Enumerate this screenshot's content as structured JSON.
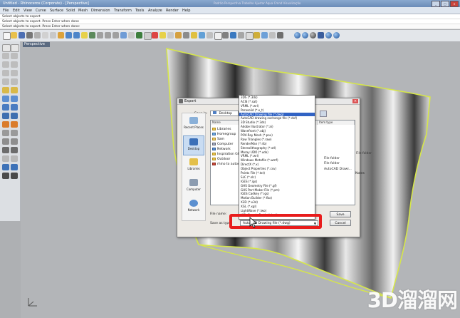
{
  "window": {
    "title": "Untitled - Rhinoceros (Corporate) - [Perspective]",
    "menu_extra": "Padrão  Perspectiva  Trabalho  Ajustar  Aqua  Cmnd  Visualização"
  },
  "menu": [
    "File",
    "Edit",
    "View",
    "Curve",
    "Surface",
    "Solid",
    "Mesh",
    "Dimension",
    "Transform",
    "Tools",
    "Analyze",
    "Render",
    "Help"
  ],
  "command": {
    "line1": "Select objects to export",
    "line2": "Select objects to export. Press Enter when done",
    "line3": "Select objects to export. Press Enter when done:"
  },
  "viewport": {
    "tab_label": "Perspective"
  },
  "dialog": {
    "title": "Export",
    "save_in_label": "Save in:",
    "save_in_value": "Desktop",
    "places": [
      "Recent Places",
      "Desktop",
      "Libraries",
      "Computer",
      "Network"
    ],
    "columns": {
      "name": "Name",
      "type": "Item type"
    },
    "files": [
      {
        "name": "Libraries",
        "type": ""
      },
      {
        "name": "Homegroup",
        "type": ""
      },
      {
        "name": "Sam",
        "type": ""
      },
      {
        "name": "Computer",
        "type": ""
      },
      {
        "name": "Network",
        "type": ""
      },
      {
        "name": "Inspiration Gl...",
        "type": "File folder"
      },
      {
        "name": "Outdoor",
        "type": "File folder"
      },
      {
        "name": "rhino to autoc...",
        "type": "AutoCAD Drawi..."
      }
    ],
    "file_name_label": "File name:",
    "save_type_label": "Save as type:",
    "save_type_value": "AutoCAD Drawing file (*.dwg)",
    "save_button": "Save",
    "cancel_button": "Cancel",
    "side_label": "Notes"
  },
  "dropdown": {
    "selected_index": 4,
    "options": [
      "3DS (*.3ds)",
      "ACIS (*.sat)",
      "VRML (*.wrl)",
      "Parasolid (*.x_t)",
      "AutoCAD Drawing file (*.dwg)",
      "AutoCAD drawing exchange file (*.dxf)",
      "3D Studio (*.3ds)",
      "Adobe Illustrator (*.ai)",
      "Wavefront (*.obj)",
      "POV-Ray Mesh (*.pov)",
      "Raw Triangles (*.raw)",
      "RenderMan (*.rib)",
      "Stereolithography (*.stl)",
      "Moray UDO (*.udo)",
      "VRML (*.wrl)",
      "Windows Metafile (*.wmf)",
      "DirectX (*.x)",
      "Object Properties (*.csv)",
      "Points File (*.txt)",
      "SLC (*.slc)",
      "IGES (*.igs)",
      "GHS Geometry File (*.gf)",
      "GHS Part Maker File (*.pm)",
      "IGES Cadkey (*.igs)",
      "Motion Builder (*.fbx)",
      "X3D (*.x3d)",
      "XGL (*.xgl)",
      "LightWave (*.lwo)",
      "KML Google Earth (*.kml)"
    ]
  },
  "watermark": "3D溜溜网",
  "colors": {
    "titlebar": "#6a8bb8",
    "highlight": "#e81c1c",
    "selected": "#3163c4",
    "surface_outline": "#d6e64a"
  }
}
